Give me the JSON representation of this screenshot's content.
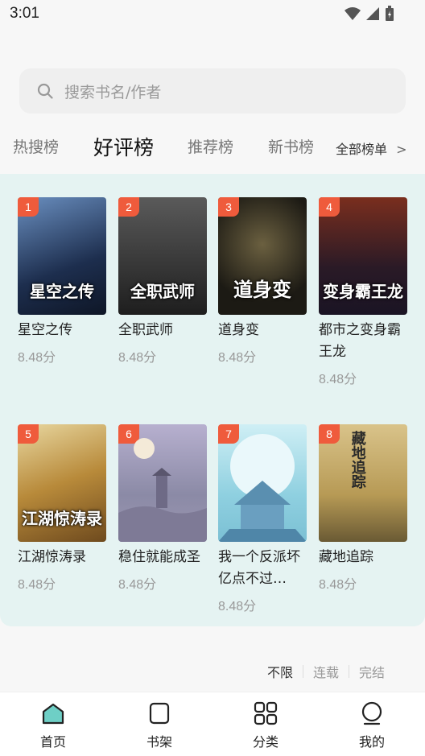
{
  "status": {
    "time": "3:01"
  },
  "search": {
    "placeholder": "搜索书名/作者"
  },
  "tabs": [
    {
      "label": "热搜榜"
    },
    {
      "label": "好评榜"
    },
    {
      "label": "推荐榜"
    },
    {
      "label": "新书榜"
    }
  ],
  "all_lists": {
    "label": "全部榜单",
    "chevron": ">"
  },
  "books": [
    {
      "rank": "1",
      "title": "星空之传",
      "score": "8.48分",
      "cover_text": "星空之传",
      "cover_color": "#2d4a6e"
    },
    {
      "rank": "2",
      "title": "全职武师",
      "score": "8.48分",
      "cover_text": "全职武师",
      "cover_color": "#3a3a3a"
    },
    {
      "rank": "3",
      "title": "道身变",
      "score": "8.48分",
      "cover_text": "道身变",
      "cover_color": "#2e2a22"
    },
    {
      "rank": "4",
      "title": "都市之变身霸王龙",
      "score": "8.48分",
      "cover_text": "变身霸王龙",
      "cover_color": "#4a2a2a"
    },
    {
      "rank": "5",
      "title": "江湖惊涛录",
      "score": "8.48分",
      "cover_text": "江湖惊涛录",
      "cover_color": "#b68a3a"
    },
    {
      "rank": "6",
      "title": "稳住就能成圣",
      "score": "8.48分",
      "cover_text": "",
      "cover_color": "#a7a2c3"
    },
    {
      "rank": "7",
      "title": "我一个反派坏亿点不过…",
      "score": "8.48分",
      "cover_text": "",
      "cover_color": "#8fd0e0"
    },
    {
      "rank": "8",
      "title": "藏地追踪",
      "score": "8.48分",
      "cover_text": "藏地追踪",
      "cover_color": "#b79a55"
    }
  ],
  "filters": [
    {
      "label": "不限"
    },
    {
      "label": "连载"
    },
    {
      "label": "完结"
    }
  ],
  "nav": [
    {
      "label": "首页",
      "icon": "home-icon"
    },
    {
      "label": "书架",
      "icon": "bookshelf-icon"
    },
    {
      "label": "分类",
      "icon": "category-icon"
    },
    {
      "label": "我的",
      "icon": "profile-icon"
    }
  ],
  "colors": {
    "accent": "#6ecfc6",
    "panel": "#e5f3f2",
    "rank_badge": "#ef5b3c"
  }
}
